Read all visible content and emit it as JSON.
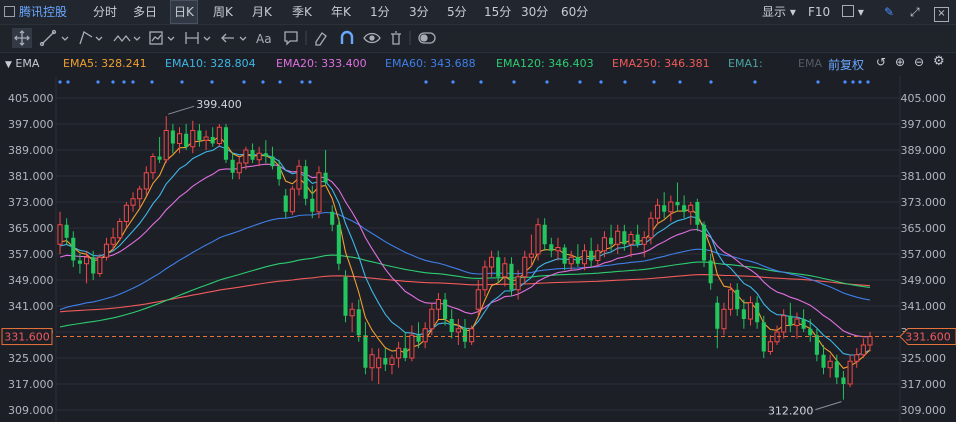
{
  "toolbar": {
    "stock_name": "腾讯控股",
    "timeframes": [
      "分时",
      "多日",
      "日K",
      "周K",
      "月K",
      "季K",
      "年K",
      "1分",
      "3分",
      "5分",
      "15分",
      "30分",
      "60分"
    ],
    "active_timeframe": "日K",
    "display_label": "显示",
    "f10_label": "F10"
  },
  "legend": {
    "indicator": "EMA",
    "items": [
      {
        "label": "EMA5: 328.241",
        "color": "#f0a030"
      },
      {
        "label": "EMA10: 328.804",
        "color": "#3fb7e8"
      },
      {
        "label": "EMA20: 333.400",
        "color": "#e070e0"
      },
      {
        "label": "EMA60: 343.688",
        "color": "#3f7fe8"
      },
      {
        "label": "EMA120: 346.403",
        "color": "#2ecc71"
      },
      {
        "label": "EMA250: 346.381",
        "color": "#f05a5a"
      },
      {
        "label": "EMA1:",
        "color": "#4aa3a0"
      },
      {
        "label": "EMA",
        "color": "#555a66"
      }
    ],
    "adjust_label": "前复权"
  },
  "chart_data": {
    "type": "candlestick",
    "y_ticks": [
      "405.000",
      "397.000",
      "389.000",
      "381.000",
      "373.000",
      "365.000",
      "357.000",
      "349.000",
      "341.000",
      "333.000",
      "325.000",
      "317.000",
      "309.000"
    ],
    "ylim": [
      309,
      405
    ],
    "current_price": 331.6,
    "current_price_label": "331.600",
    "high_annotation": "399.400",
    "low_annotation": "312.200",
    "candles": [
      {
        "o": 360,
        "h": 370,
        "l": 357,
        "c": 366
      },
      {
        "o": 366,
        "h": 368,
        "l": 360,
        "c": 362
      },
      {
        "o": 362,
        "h": 364,
        "l": 353,
        "c": 355
      },
      {
        "o": 355,
        "h": 357,
        "l": 351,
        "c": 354
      },
      {
        "o": 354,
        "h": 358,
        "l": 348,
        "c": 356
      },
      {
        "o": 356,
        "h": 358,
        "l": 349,
        "c": 351
      },
      {
        "o": 351,
        "h": 357,
        "l": 350,
        "c": 356
      },
      {
        "o": 356,
        "h": 362,
        "l": 355,
        "c": 360
      },
      {
        "o": 360,
        "h": 365,
        "l": 358,
        "c": 362
      },
      {
        "o": 362,
        "h": 368,
        "l": 361,
        "c": 367
      },
      {
        "o": 367,
        "h": 373,
        "l": 365,
        "c": 372
      },
      {
        "o": 372,
        "h": 376,
        "l": 370,
        "c": 374
      },
      {
        "o": 374,
        "h": 378,
        "l": 371,
        "c": 377
      },
      {
        "o": 377,
        "h": 384,
        "l": 375,
        "c": 382
      },
      {
        "o": 382,
        "h": 388,
        "l": 380,
        "c": 387
      },
      {
        "o": 387,
        "h": 393,
        "l": 385,
        "c": 386
      },
      {
        "o": 386,
        "h": 399.4,
        "l": 385,
        "c": 395
      },
      {
        "o": 395,
        "h": 397,
        "l": 388,
        "c": 391
      },
      {
        "o": 391,
        "h": 396,
        "l": 388,
        "c": 394
      },
      {
        "o": 394,
        "h": 397,
        "l": 389,
        "c": 390
      },
      {
        "o": 390,
        "h": 398,
        "l": 388,
        "c": 395
      },
      {
        "o": 395,
        "h": 397,
        "l": 390,
        "c": 392
      },
      {
        "o": 392,
        "h": 395,
        "l": 389,
        "c": 393
      },
      {
        "o": 393,
        "h": 396,
        "l": 390,
        "c": 391
      },
      {
        "o": 391,
        "h": 397,
        "l": 390,
        "c": 396
      },
      {
        "o": 396,
        "h": 397,
        "l": 385,
        "c": 386
      },
      {
        "o": 386,
        "h": 388,
        "l": 380,
        "c": 382
      },
      {
        "o": 382,
        "h": 387,
        "l": 380,
        "c": 385
      },
      {
        "o": 385,
        "h": 390,
        "l": 383,
        "c": 389
      },
      {
        "o": 389,
        "h": 391,
        "l": 385,
        "c": 386
      },
      {
        "o": 386,
        "h": 390,
        "l": 384,
        "c": 388
      },
      {
        "o": 388,
        "h": 392,
        "l": 385,
        "c": 387
      },
      {
        "o": 387,
        "h": 390,
        "l": 383,
        "c": 384
      },
      {
        "o": 384,
        "h": 386,
        "l": 378,
        "c": 380
      },
      {
        "o": 375,
        "h": 377,
        "l": 368,
        "c": 370
      },
      {
        "o": 370,
        "h": 378,
        "l": 369,
        "c": 377
      },
      {
        "o": 377,
        "h": 386,
        "l": 375,
        "c": 384
      },
      {
        "o": 384,
        "h": 386,
        "l": 372,
        "c": 374
      },
      {
        "o": 374,
        "h": 378,
        "l": 368,
        "c": 370
      },
      {
        "o": 370,
        "h": 384,
        "l": 368,
        "c": 382
      },
      {
        "o": 382,
        "h": 389,
        "l": 378,
        "c": 379
      },
      {
        "o": 370,
        "h": 372,
        "l": 364,
        "c": 366
      },
      {
        "o": 366,
        "h": 368,
        "l": 352,
        "c": 354
      },
      {
        "o": 350,
        "h": 352,
        "l": 336,
        "c": 338
      },
      {
        "o": 338,
        "h": 342,
        "l": 333,
        "c": 340
      },
      {
        "o": 340,
        "h": 343,
        "l": 330,
        "c": 332
      },
      {
        "o": 332,
        "h": 336,
        "l": 320,
        "c": 322
      },
      {
        "o": 322,
        "h": 328,
        "l": 318,
        "c": 326
      },
      {
        "o": 322,
        "h": 328,
        "l": 317,
        "c": 325
      },
      {
        "o": 325,
        "h": 328,
        "l": 321,
        "c": 323
      },
      {
        "o": 323,
        "h": 326,
        "l": 320,
        "c": 325
      },
      {
        "o": 325,
        "h": 330,
        "l": 322,
        "c": 328
      },
      {
        "o": 328,
        "h": 333,
        "l": 324,
        "c": 325
      },
      {
        "o": 325,
        "h": 335,
        "l": 324,
        "c": 332
      },
      {
        "o": 332,
        "h": 336,
        "l": 328,
        "c": 330
      },
      {
        "o": 330,
        "h": 336,
        "l": 328,
        "c": 334
      },
      {
        "o": 334,
        "h": 342,
        "l": 332,
        "c": 340
      },
      {
        "o": 340,
        "h": 345,
        "l": 337,
        "c": 343
      },
      {
        "o": 343,
        "h": 345,
        "l": 335,
        "c": 337
      },
      {
        "o": 337,
        "h": 340,
        "l": 331,
        "c": 333
      },
      {
        "o": 333,
        "h": 337,
        "l": 329,
        "c": 334
      },
      {
        "o": 334,
        "h": 337,
        "l": 328,
        "c": 330
      },
      {
        "o": 330,
        "h": 335,
        "l": 329,
        "c": 334
      },
      {
        "o": 340,
        "h": 349,
        "l": 338,
        "c": 346
      },
      {
        "o": 346,
        "h": 355,
        "l": 344,
        "c": 353
      },
      {
        "o": 353,
        "h": 358,
        "l": 350,
        "c": 356
      },
      {
        "o": 356,
        "h": 358,
        "l": 348,
        "c": 350
      },
      {
        "o": 350,
        "h": 356,
        "l": 347,
        "c": 354
      },
      {
        "o": 354,
        "h": 356,
        "l": 344,
        "c": 346
      },
      {
        "o": 346,
        "h": 352,
        "l": 343,
        "c": 350
      },
      {
        "o": 350,
        "h": 358,
        "l": 348,
        "c": 356
      },
      {
        "o": 356,
        "h": 363,
        "l": 353,
        "c": 357
      },
      {
        "o": 357,
        "h": 368,
        "l": 355,
        "c": 366
      },
      {
        "o": 366,
        "h": 368,
        "l": 358,
        "c": 360
      },
      {
        "o": 360,
        "h": 362,
        "l": 356,
        "c": 358
      },
      {
        "o": 358,
        "h": 362,
        "l": 355,
        "c": 359
      },
      {
        "o": 359,
        "h": 360,
        "l": 352,
        "c": 354
      },
      {
        "o": 354,
        "h": 358,
        "l": 352,
        "c": 356
      },
      {
        "o": 356,
        "h": 360,
        "l": 353,
        "c": 354
      },
      {
        "o": 354,
        "h": 360,
        "l": 352,
        "c": 358
      },
      {
        "o": 358,
        "h": 362,
        "l": 353,
        "c": 355
      },
      {
        "o": 355,
        "h": 360,
        "l": 353,
        "c": 358
      },
      {
        "o": 358,
        "h": 364,
        "l": 356,
        "c": 362
      },
      {
        "o": 362,
        "h": 366,
        "l": 358,
        "c": 360
      },
      {
        "o": 360,
        "h": 366,
        "l": 357,
        "c": 364
      },
      {
        "o": 364,
        "h": 366,
        "l": 358,
        "c": 360
      },
      {
        "o": 360,
        "h": 364,
        "l": 356,
        "c": 363
      },
      {
        "o": 363,
        "h": 366,
        "l": 359,
        "c": 360
      },
      {
        "o": 360,
        "h": 364,
        "l": 356,
        "c": 362
      },
      {
        "o": 362,
        "h": 370,
        "l": 360,
        "c": 368
      },
      {
        "o": 368,
        "h": 374,
        "l": 366,
        "c": 372
      },
      {
        "o": 372,
        "h": 376,
        "l": 368,
        "c": 370
      },
      {
        "o": 370,
        "h": 375,
        "l": 367,
        "c": 373
      },
      {
        "o": 373,
        "h": 379,
        "l": 370,
        "c": 372
      },
      {
        "o": 372,
        "h": 375,
        "l": 368,
        "c": 370
      },
      {
        "o": 370,
        "h": 373,
        "l": 366,
        "c": 372
      },
      {
        "o": 373,
        "h": 374,
        "l": 364,
        "c": 366
      },
      {
        "o": 366,
        "h": 367,
        "l": 353,
        "c": 355
      },
      {
        "o": 355,
        "h": 357,
        "l": 346,
        "c": 348
      },
      {
        "o": 342,
        "h": 344,
        "l": 328,
        "c": 334
      },
      {
        "o": 334,
        "h": 342,
        "l": 332,
        "c": 340
      },
      {
        "o": 340,
        "h": 348,
        "l": 338,
        "c": 346
      },
      {
        "o": 346,
        "h": 348,
        "l": 338,
        "c": 340
      },
      {
        "o": 340,
        "h": 343,
        "l": 334,
        "c": 337
      },
      {
        "o": 337,
        "h": 344,
        "l": 335,
        "c": 342
      },
      {
        "o": 342,
        "h": 344,
        "l": 334,
        "c": 336
      },
      {
        "o": 336,
        "h": 338,
        "l": 325,
        "c": 327
      },
      {
        "o": 327,
        "h": 332,
        "l": 326,
        "c": 330
      },
      {
        "o": 330,
        "h": 335,
        "l": 329,
        "c": 333
      },
      {
        "o": 333,
        "h": 340,
        "l": 331,
        "c": 338
      },
      {
        "o": 338,
        "h": 342,
        "l": 333,
        "c": 335
      },
      {
        "o": 335,
        "h": 339,
        "l": 331,
        "c": 337
      },
      {
        "o": 337,
        "h": 340,
        "l": 333,
        "c": 334
      },
      {
        "o": 334,
        "h": 337,
        "l": 330,
        "c": 332
      },
      {
        "o": 332,
        "h": 334,
        "l": 324,
        "c": 326
      },
      {
        "o": 326,
        "h": 329,
        "l": 320,
        "c": 322
      },
      {
        "o": 322,
        "h": 326,
        "l": 319,
        "c": 324
      },
      {
        "o": 324,
        "h": 326,
        "l": 317,
        "c": 319
      },
      {
        "o": 319,
        "h": 321,
        "l": 312.2,
        "c": 317
      },
      {
        "o": 317,
        "h": 326,
        "l": 316,
        "c": 324
      },
      {
        "o": 324,
        "h": 328,
        "l": 322,
        "c": 326
      },
      {
        "o": 326,
        "h": 331,
        "l": 325,
        "c": 329
      },
      {
        "o": 329,
        "h": 333,
        "l": 327,
        "c": 331.6
      }
    ]
  }
}
